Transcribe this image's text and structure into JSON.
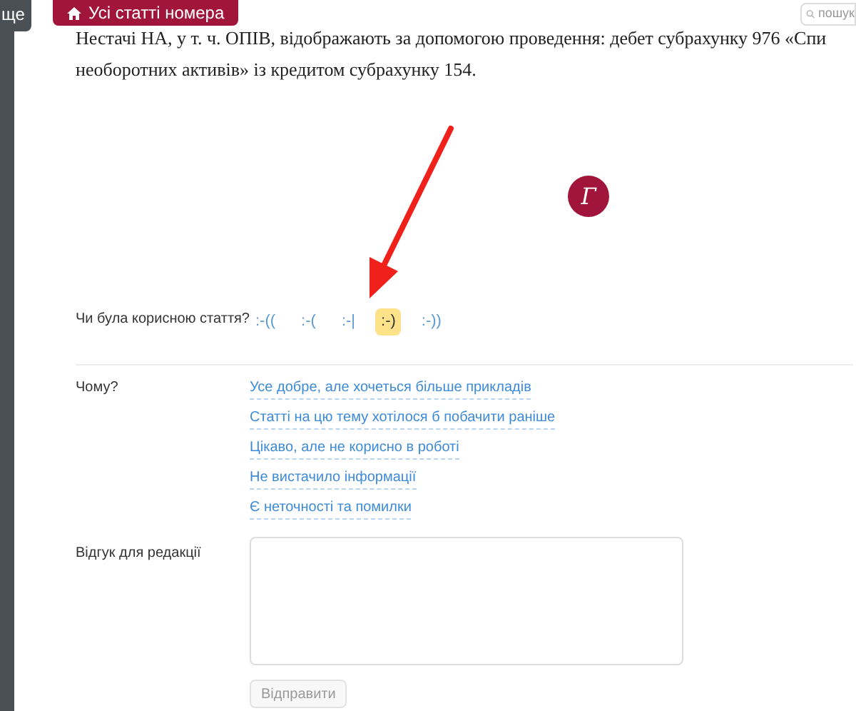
{
  "side_tab": {
    "label": "ще"
  },
  "top_button": {
    "label": "Усі статті номера"
  },
  "search": {
    "placeholder": "пошук"
  },
  "article_lines": [
    "Нестачі НА, у т. ч. ОПІВ, відображають за допомогою проведення: дебет субрахунку 976 «Спи",
    "необоротних активів» із кредитом субрахунку 154."
  ],
  "logo": {
    "letter": "Г"
  },
  "rating": {
    "label": "Чи була корисною стаття?",
    "options": [
      {
        "label": ":-((",
        "selected": false
      },
      {
        "label": ":-(",
        "selected": false
      },
      {
        "label": ":-|",
        "selected": false
      },
      {
        "label": ":-)",
        "selected": true
      },
      {
        "label": ":-))",
        "selected": false
      }
    ]
  },
  "why": {
    "label": "Чому?",
    "reasons": [
      "Усе добре, але хочеться більше прикладів",
      "Статті на цю тему хотілося б побачити раніше",
      "Цікаво, але не корисно в роботі",
      "Не вистачило інформації",
      "Є неточності та помилки"
    ]
  },
  "feedback": {
    "label": "Відгук для редакції"
  },
  "submit": {
    "label": "Відправити",
    "disabled": true
  }
}
